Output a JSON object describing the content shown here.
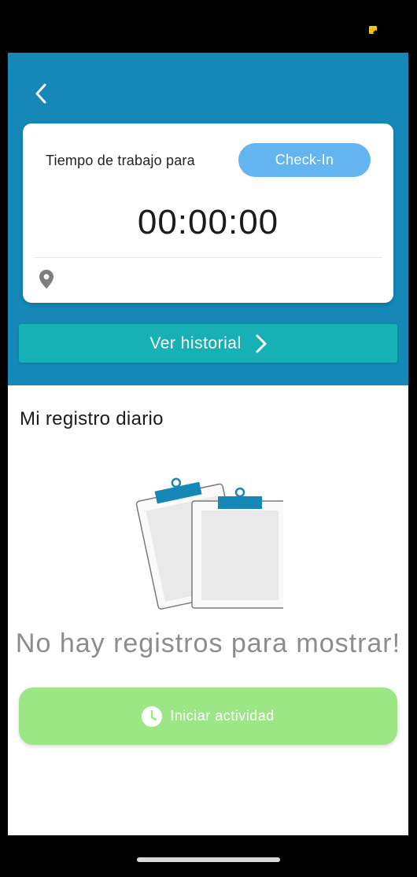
{
  "header": {
    "card": {
      "label": "Tiempo de trabajo para",
      "checkin_label": "Check-In",
      "timer": "00:00:00"
    },
    "history_label": "Ver historial"
  },
  "main": {
    "section_title": "Mi registro diario",
    "empty_message": "No hay registros para mostrar!",
    "start_button_label": "Iniciar actividad"
  },
  "colors": {
    "header_bg": "#1588b7",
    "checkin_bg": "#64b4f0",
    "history_bg": "#17b1b5",
    "start_bg": "#9de685"
  },
  "icons": [
    "back-arrow-icon",
    "location-pin-icon",
    "chevron-right-icon",
    "clipboard-illustration",
    "clock-icon"
  ]
}
